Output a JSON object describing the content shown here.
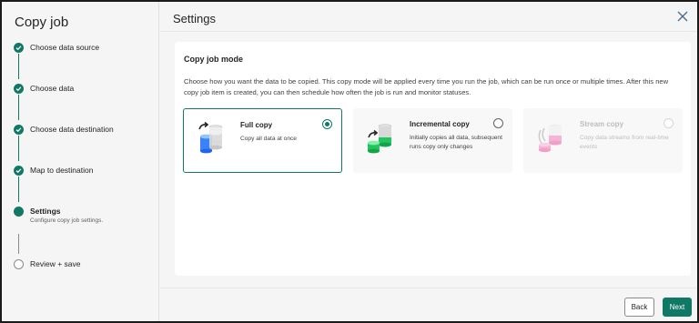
{
  "sidebar": {
    "title": "Copy job",
    "steps": [
      {
        "label": "Choose data source",
        "status": "done"
      },
      {
        "label": "Choose data",
        "status": "done"
      },
      {
        "label": "Choose data destination",
        "status": "done"
      },
      {
        "label": "Map to destination",
        "status": "done"
      },
      {
        "label": "Settings",
        "sub": "Configure copy job settings.",
        "status": "current"
      },
      {
        "label": "Review + save",
        "status": "pending"
      }
    ]
  },
  "main": {
    "title": "Settings",
    "section_title": "Copy job mode",
    "description": "Choose how you want the data to be copied. This copy mode will be applied every time you run the job, which can be run once or multiple times. After this new copy job item is created, you can then schedule how often the job is run and monitor statuses.",
    "options": [
      {
        "title": "Full copy",
        "desc": "Copy all data at once",
        "selected": true,
        "disabled": false,
        "icon": "full-copy-icon"
      },
      {
        "title": "Incremental copy",
        "desc": "Initially copies all data, subsequent runs copy only changes",
        "selected": false,
        "disabled": false,
        "icon": "incremental-copy-icon"
      },
      {
        "title": "Stream copy",
        "desc": "Copy data streams from real-time events",
        "selected": false,
        "disabled": true,
        "icon": "stream-copy-icon"
      }
    ]
  },
  "footer": {
    "back_label": "Back",
    "next_label": "Next"
  },
  "colors": {
    "accent": "#117865",
    "background": "#f5f5f5",
    "card": "#ffffff"
  }
}
